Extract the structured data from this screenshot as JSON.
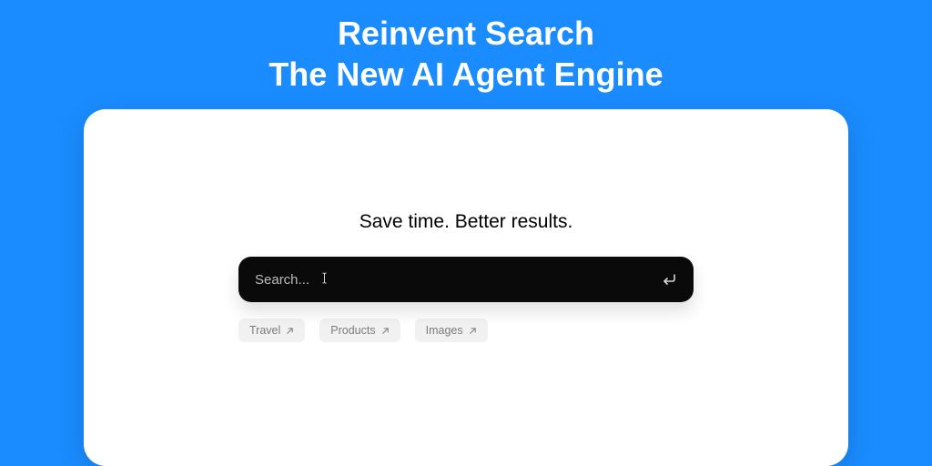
{
  "hero": {
    "line1": "Reinvent Search",
    "line2": "The New AI Agent Engine"
  },
  "card": {
    "tagline": "Save time. Better results.",
    "search": {
      "placeholder": "Search...",
      "value": ""
    },
    "chips": [
      {
        "label": "Travel"
      },
      {
        "label": "Products"
      },
      {
        "label": "Images"
      }
    ]
  }
}
